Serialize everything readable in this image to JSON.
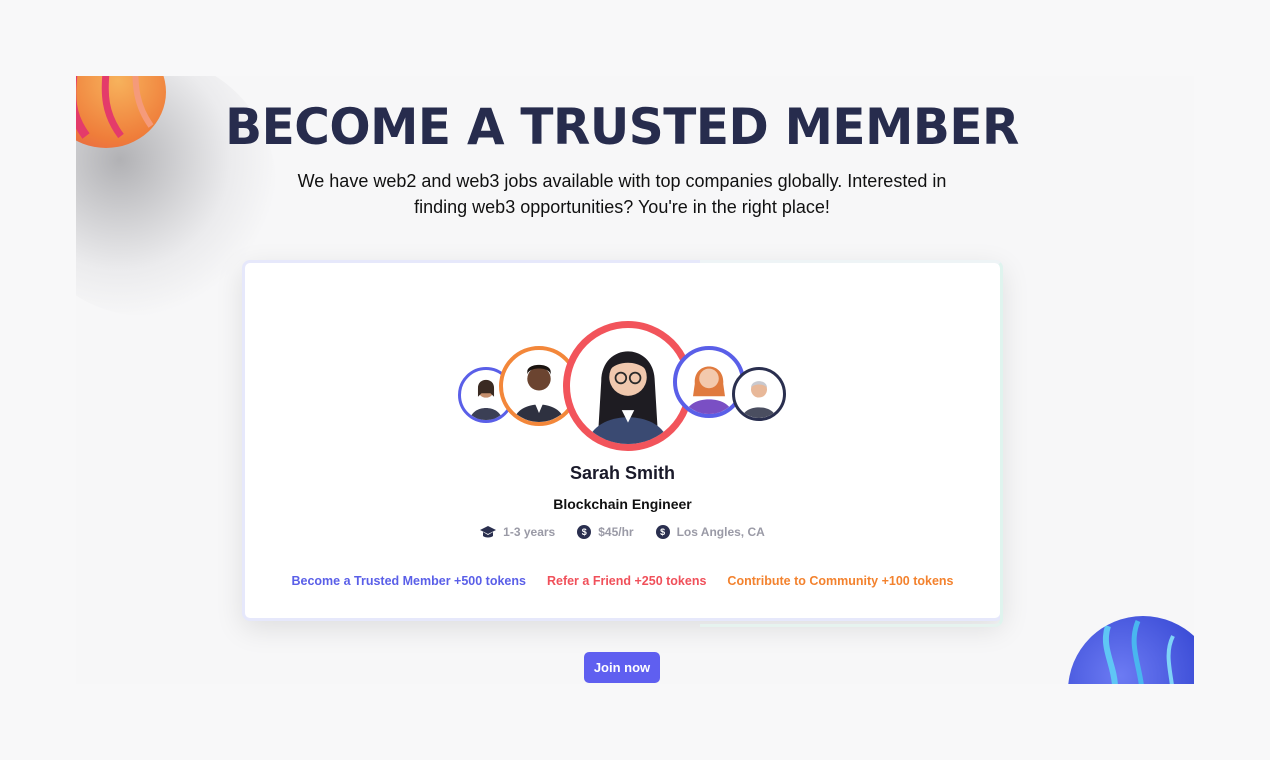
{
  "hero": {
    "title": "BECOME A TRUSTED MEMBER",
    "subtitle": "We have web2 and web3 jobs available with top companies globally. Interested in finding web3 opportunities? You're in the right place!"
  },
  "profile": {
    "name": "Sarah Smith",
    "role": "Blockchain Engineer",
    "experience": "1-3 years",
    "rate": "$45/hr",
    "location": "Los Angles, CA"
  },
  "rewards": [
    {
      "label": "Become a Trusted Member +500 tokens",
      "color": "#5a5fe8"
    },
    {
      "label": "Refer a Friend +250 tokens",
      "color": "#f0505a"
    },
    {
      "label": "Contribute to Community +100 tokens",
      "color": "#f3822e"
    }
  ],
  "cta": {
    "join_label": "Join now"
  },
  "icons": {
    "experience": "graduation-cap-icon",
    "rate": "dollar-icon",
    "location": "dollar-icon"
  },
  "colors": {
    "accent": "#5f5ff0",
    "title": "#272c4d",
    "ring_red": "#f2545b",
    "ring_orange": "#f3873a",
    "ring_blue": "#5a5fe8",
    "ring_dark": "#2a2f4f"
  }
}
